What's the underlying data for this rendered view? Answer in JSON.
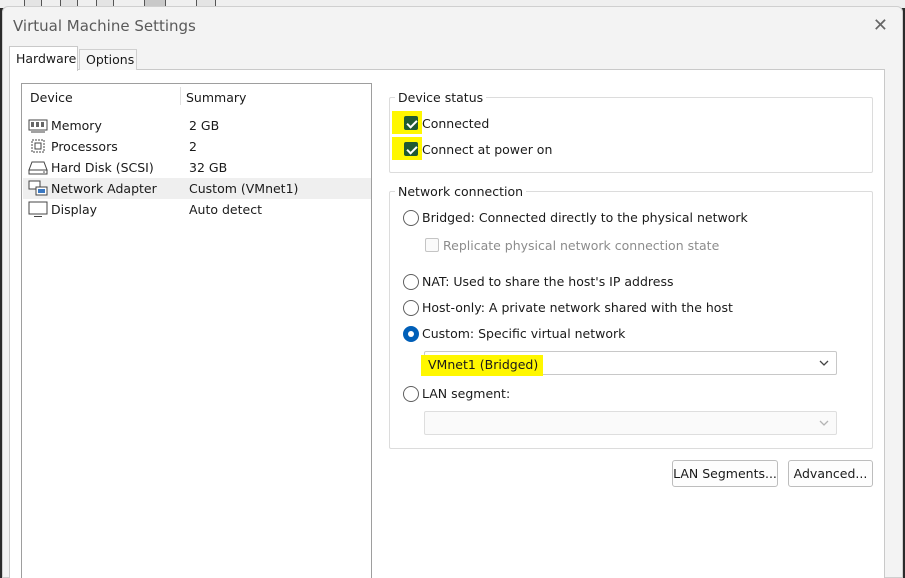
{
  "window": {
    "title": "Virtual Machine Settings",
    "close_glyph": "✕"
  },
  "tabs": [
    {
      "label": "Hardware",
      "active": true
    },
    {
      "label": "Options",
      "active": false
    }
  ],
  "device_list": {
    "headers": {
      "device": "Device",
      "summary": "Summary"
    },
    "rows": [
      {
        "device": "Memory",
        "summary": "2 GB",
        "icon": "memory-icon"
      },
      {
        "device": "Processors",
        "summary": "2",
        "icon": "processor-icon"
      },
      {
        "device": "Hard Disk (SCSI)",
        "summary": "32 GB",
        "icon": "hard-disk-icon"
      },
      {
        "device": "Network Adapter",
        "summary": "Custom (VMnet1)",
        "icon": "network-adapter-icon",
        "selected": true
      },
      {
        "device": "Display",
        "summary": "Auto detect",
        "icon": "display-icon"
      }
    ]
  },
  "device_status": {
    "label": "Device status",
    "connected": {
      "label": "Connected",
      "checked": true
    },
    "connect_at_power_on": {
      "label": "Connect at power on",
      "checked": true
    }
  },
  "network_connection": {
    "label": "Network connection",
    "bridged": {
      "label": "Bridged: Connected directly to the physical network",
      "selected": false
    },
    "replicate": {
      "label": "Replicate physical network connection state",
      "checked": false
    },
    "nat": {
      "label": "NAT: Used to share the host's IP address",
      "selected": false
    },
    "host_only": {
      "label": "Host-only: A private network shared with the host",
      "selected": false
    },
    "custom": {
      "label": "Custom: Specific virtual network",
      "selected": true
    },
    "custom_network_value": "VMnet1 (Bridged)",
    "lan_segment": {
      "label": "LAN segment:",
      "selected": false
    },
    "lan_segment_value": ""
  },
  "buttons": {
    "lan_segments": "LAN Segments...",
    "advanced": "Advanced..."
  },
  "colors": {
    "highlight": "#fff700",
    "checkbox_checked": "#1f5a33",
    "radio_selected": "#005fb8"
  }
}
